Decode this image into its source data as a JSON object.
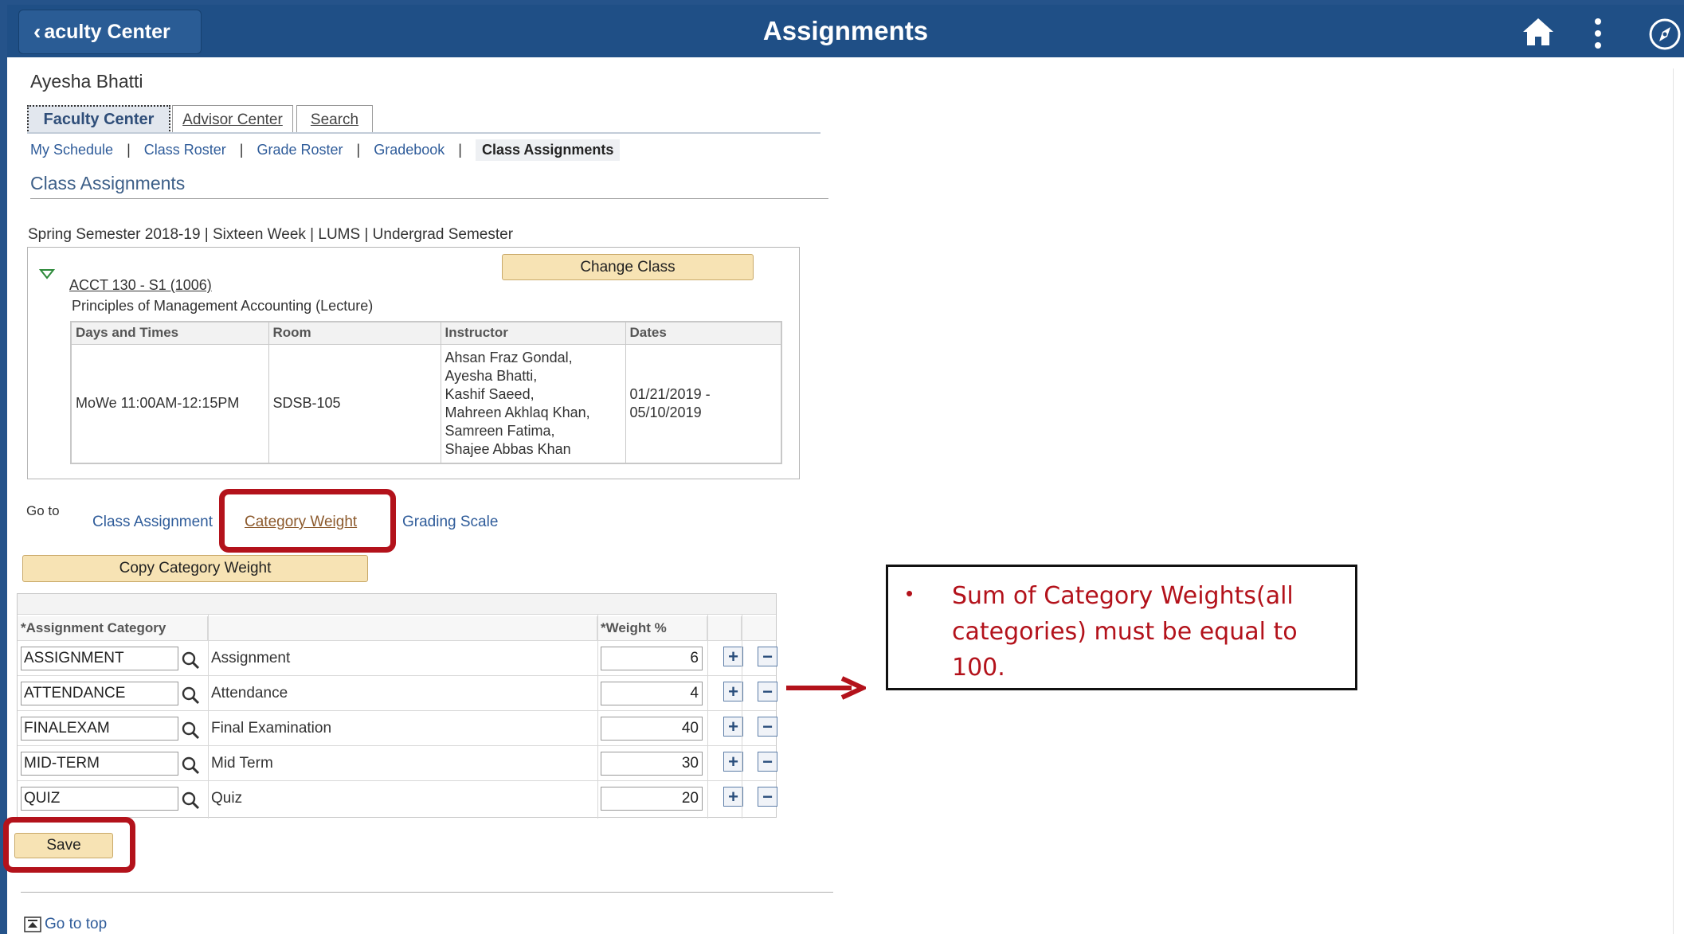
{
  "header": {
    "back_label": "aculty Center",
    "title": "Assignments"
  },
  "user_name": "Ayesha Bhatti",
  "tabs": [
    {
      "label": "Faculty Center"
    },
    {
      "label": "Advisor Center"
    },
    {
      "label": "Search"
    }
  ],
  "subnav": [
    {
      "label": "My Schedule"
    },
    {
      "label": "Class Roster"
    },
    {
      "label": "Grade Roster"
    },
    {
      "label": "Gradebook"
    },
    {
      "label": "Class Assignments"
    }
  ],
  "section_title": "Class Assignments",
  "term": "Spring Semester 2018-19 | Sixteen Week | LUMS | Undergrad Semester",
  "class_info": {
    "change_class_label": "Change Class",
    "course_link": "ACCT 130 - S1 (1006)",
    "course_desc": "Principles of Management Accounting (Lecture)",
    "headers": [
      "Days and Times",
      "Room",
      "Instructor",
      "Dates"
    ],
    "days_times": "MoWe 11:00AM-12:15PM",
    "room": "SDSB-105",
    "instructors": [
      "Ahsan Fraz Gondal,",
      "Ayesha Bhatti,",
      "Kashif Saeed,",
      "Mahreen Akhlaq Khan,",
      "Samreen Fatima,",
      "Shajee Abbas Khan"
    ],
    "dates": [
      "01/21/2019 -",
      "05/10/2019"
    ]
  },
  "goto": {
    "label": "Go to",
    "links": [
      {
        "label": "Class Assignment"
      },
      {
        "label": "Category Weight"
      },
      {
        "label": "Grading Scale"
      }
    ]
  },
  "copy_weight_label": "Copy Category Weight",
  "grid": {
    "headers": {
      "category": "*Assignment Category",
      "weight": "*Weight %"
    },
    "rows": [
      {
        "code": "ASSIGNMENT",
        "desc": "Assignment",
        "weight": "6"
      },
      {
        "code": "ATTENDANCE",
        "desc": "Attendance",
        "weight": "4"
      },
      {
        "code": "FINALEXAM",
        "desc": "Final Examination",
        "weight": "40"
      },
      {
        "code": "MID-TERM",
        "desc": "Mid Term",
        "weight": "30"
      },
      {
        "code": "QUIZ",
        "desc": "Quiz",
        "weight": "20"
      }
    ],
    "plus_symbol": "+",
    "minus_symbol": "−"
  },
  "save_label": "Save",
  "goto_top_label": "Go to top",
  "callout": {
    "bullet": "•",
    "text": "Sum of Category Weights(all categories) must be equal to 100."
  },
  "colors": {
    "header_bg": "#1f4f86",
    "highlight": "#b3121b",
    "button_bg": "#f7e3b4",
    "link": "#2f5c9a"
  },
  "icons": [
    "chevron-left-icon",
    "home-icon",
    "more-vertical-icon",
    "navigator-icon",
    "collapse-triangle-icon",
    "lookup-magnifier-icon",
    "add-row-icon",
    "delete-row-icon",
    "go-to-top-icon",
    "arrow-right-icon"
  ]
}
